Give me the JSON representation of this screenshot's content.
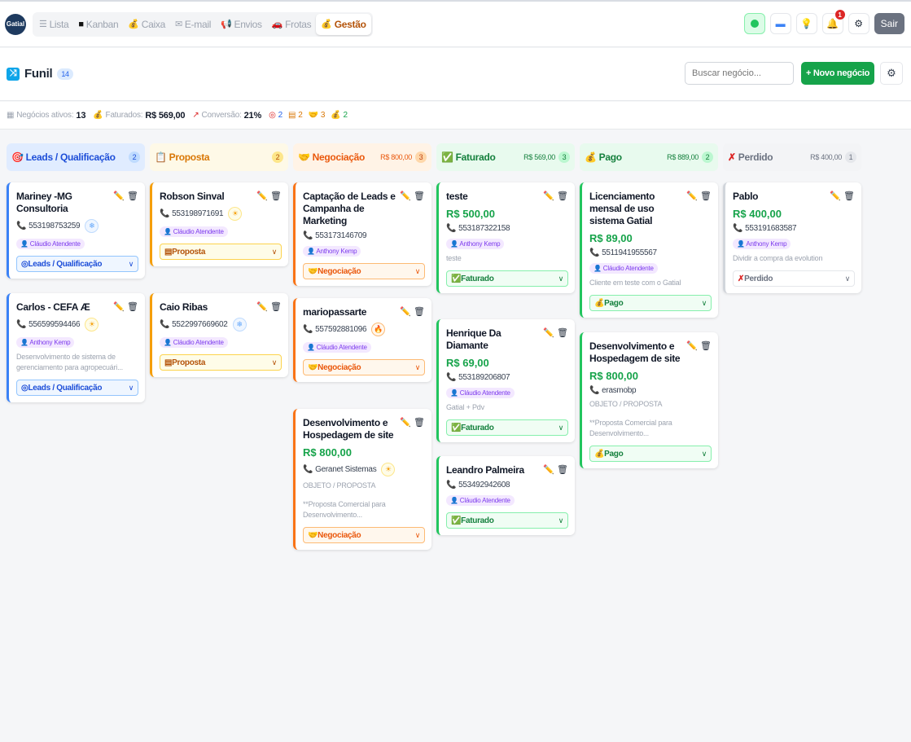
{
  "nav": {
    "logo_text": "Gatial",
    "tabs": [
      {
        "icon": "☰",
        "label": "Lista"
      },
      {
        "icon": "■",
        "label": "Kanban"
      },
      {
        "icon": "💰",
        "label": "Caixa"
      },
      {
        "icon": "✉",
        "label": "E-mail"
      },
      {
        "icon": "📢",
        "label": "Envios"
      },
      {
        "icon": "🚗",
        "label": "Frotas"
      },
      {
        "icon": "💰",
        "label": "Gestão"
      }
    ],
    "active_tab": "Gestão",
    "notification_count": "1",
    "logout_label": "Sair"
  },
  "header": {
    "title": "Funil",
    "count": "14",
    "search_placeholder": "Buscar negócio...",
    "new_button": "+ Novo negócio"
  },
  "stats": {
    "active_label": "Negócios ativos:",
    "active_value": "13",
    "billed_label": "Faturados:",
    "billed_value": "R$ 569,00",
    "conversion_label": "Conversão:",
    "conversion_value": "21%",
    "leads_count": "2",
    "proposal_count": "2",
    "negotiation_count": "3",
    "paid_count": "2"
  },
  "columns": [
    {
      "title": "Leads / Qualificação",
      "icon": "🎯",
      "total": "",
      "count": "2"
    },
    {
      "title": "Proposta",
      "icon": "📋",
      "total": "",
      "count": "2"
    },
    {
      "title": "Negociação",
      "icon": "🤝",
      "total": "R$ 800,00",
      "count": "3"
    },
    {
      "title": "Faturado",
      "icon": "✅",
      "total": "R$ 569,00",
      "count": "3"
    },
    {
      "title": "Pago",
      "icon": "💰",
      "total": "R$ 889,00",
      "count": "2"
    },
    {
      "title": "Perdido",
      "icon": "✗",
      "total": "R$ 400,00",
      "count": "1"
    }
  ],
  "cards": {
    "leads_1": {
      "title": "Mariney -MG Consultoria",
      "phone": "553198753259",
      "agent": "Cláudio Atendente",
      "stage": "Leads / Qualificação"
    },
    "leads_2": {
      "title": "Carlos - CEFA Æ",
      "phone": "556599594466",
      "agent": "Anthony Kemp",
      "desc": "Desenvolvimento de sistema de gerenciamento para agropecuári...",
      "stage": "Leads / Qualificação"
    },
    "prop_1": {
      "title": "Robson Sinval",
      "phone": "553198971691",
      "agent": "Cláudio Atendente",
      "stage": "Proposta"
    },
    "prop_2": {
      "title": "Caio Ribas",
      "phone": "5522997669602",
      "agent": "Cláudio Atendente",
      "stage": "Proposta"
    },
    "neg_1": {
      "title": "Captação de Leads e Campanha de Marketing",
      "phone": "553173146709",
      "agent": "Anthony Kemp",
      "stage": "Negociação"
    },
    "neg_2": {
      "title": "mariopassarte",
      "phone": "557592881096",
      "agent": "Cláudio Atendente",
      "stage": "Negociação"
    },
    "neg_3": {
      "title": "Desenvolvimento e Hospedagem de site",
      "price": "R$ 800,00",
      "phone": "Geranet Sistemas",
      "desc1": "OBJETO / PROPOSTA",
      "desc2": "**Proposta Comercial para Desenvolvimento...",
      "stage": "Negociação"
    },
    "fat_1": {
      "title": "teste",
      "price": "R$ 500,00",
      "phone": "553187322158",
      "agent": "Anthony Kemp",
      "desc": "teste",
      "stage": "Faturado"
    },
    "fat_2": {
      "title": "Henrique Da Diamante",
      "price": "R$ 69,00",
      "phone": "553189206807",
      "agent": "Cláudio Atendente",
      "desc": "Gatial + Pdv",
      "stage": "Faturado"
    },
    "fat_3": {
      "title": "Leandro Palmeira",
      "phone": "553492942608",
      "agent": "Cláudio Atendente",
      "stage": "Faturado"
    },
    "pago_1": {
      "title": "Licenciamento mensal de uso sistema Gatial",
      "price": "R$ 89,00",
      "phone": "5511941955567",
      "agent": "Cláudio Atendente",
      "desc": "Cliente em teste com o Gatial",
      "stage": "Pago"
    },
    "pago_2": {
      "title": "Desenvolvimento e Hospedagem de site",
      "price": "R$ 800,00",
      "phone": "erasmobp",
      "desc1": "OBJETO / PROPOSTA",
      "desc2": "**Proposta Comercial para Desenvolvimento...",
      "stage": "Pago"
    },
    "perd_1": {
      "title": "Pablo",
      "price": "R$ 400,00",
      "phone": "553191683587",
      "agent": "Anthony Kemp",
      "desc": "Dividir a compra da evolution",
      "stage": "Perdido"
    }
  }
}
